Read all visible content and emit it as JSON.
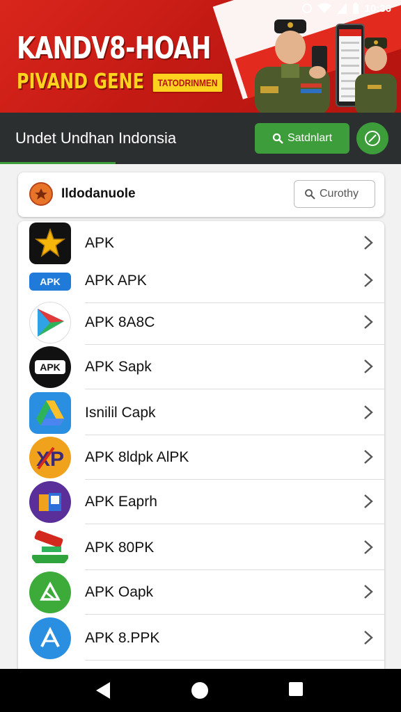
{
  "status_bar": {
    "time": "10:36"
  },
  "banner": {
    "title_line1": "KANDV8-HOAH",
    "title_line2": "PIVAND GENE",
    "tag": "TATODRINMEN"
  },
  "navbar": {
    "title": "Undet Undhan  Indonsia",
    "search_button": "Satdnlart"
  },
  "search_card": {
    "name": "Ildodanuole",
    "search_placeholder": "Curothy"
  },
  "apps": [
    {
      "label": "APK",
      "icon": "star-icon"
    },
    {
      "label": "APK APK",
      "icon": "apkpure-icon"
    },
    {
      "label": "APK 8A8C",
      "icon": "play-icon"
    },
    {
      "label": "APK Sapk",
      "icon": "apk-badge-icon"
    },
    {
      "label": "Isnilil Capk",
      "icon": "drive-icon"
    },
    {
      "label": "APK 8ldpk AlPK",
      "icon": "xp-icon"
    },
    {
      "label": "APK Eaprh",
      "icon": "book-icon"
    },
    {
      "label": "APK 80PK",
      "icon": "tool-icon"
    },
    {
      "label": "APK Oapk",
      "icon": "green-apk-icon"
    },
    {
      "label": "APK 8.PPK",
      "icon": "blue-a-icon"
    }
  ],
  "colors": {
    "banner_red": "#d9261c",
    "accent_green": "#3c9d3a",
    "navbar_dark": "#2b2f2f",
    "title_yellow": "#ffd21f"
  }
}
